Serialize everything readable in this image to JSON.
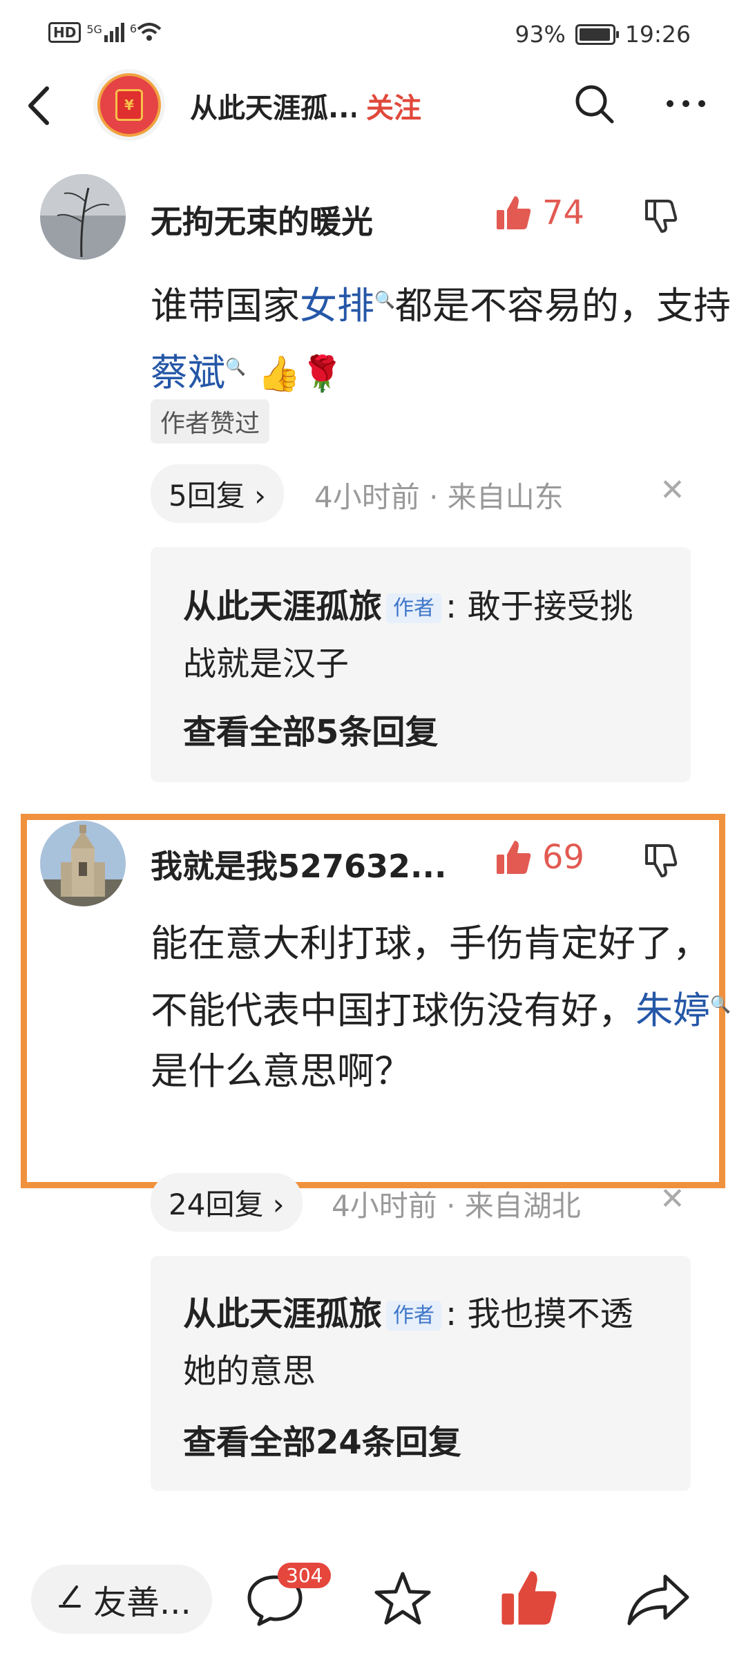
{
  "status_bar": {
    "network_label": "HD",
    "signal_label": "5G",
    "wifi_label": "6",
    "battery": "93%",
    "time": "19:26"
  },
  "header": {
    "title": "从此天涯孤...",
    "follow_label": "关注"
  },
  "comments": [
    {
      "user": "无拘无束的暖光",
      "likes": "74",
      "body_parts": [
        "谁带国家",
        "女排",
        "都是不容易的，支持",
        "蔡斌"
      ],
      "emoji": "👍🌹",
      "tag": "作者赞过",
      "reply_count": "5回复",
      "meta": "4小时前 · 来自山东",
      "author_reply": {
        "name": "从此天涯孤旅",
        "badge": "作者",
        "text": ": 敢于接受挑战就是汉子",
        "view_all": "查看全部5条回复"
      }
    },
    {
      "user": "我就是我527632...",
      "likes": "69",
      "body_parts": [
        "能在意大利打球，手伤肯定好了，不能代表中国打球伤没有好，",
        "朱婷",
        "是什么意思啊？"
      ],
      "reply_count": "24回复",
      "meta": "4小时前 · 来自湖北",
      "author_reply": {
        "name": "从此天涯孤旅",
        "badge": "作者",
        "text": ": 我也摸不透她的意思",
        "view_all": "查看全部24条回复"
      }
    }
  ],
  "bottom_bar": {
    "input_placeholder": "友善...",
    "comment_count": "304"
  },
  "colors": {
    "accent_red": "#e0483b",
    "link_blue": "#2557a7",
    "highlight_orange": "#f0913d"
  }
}
